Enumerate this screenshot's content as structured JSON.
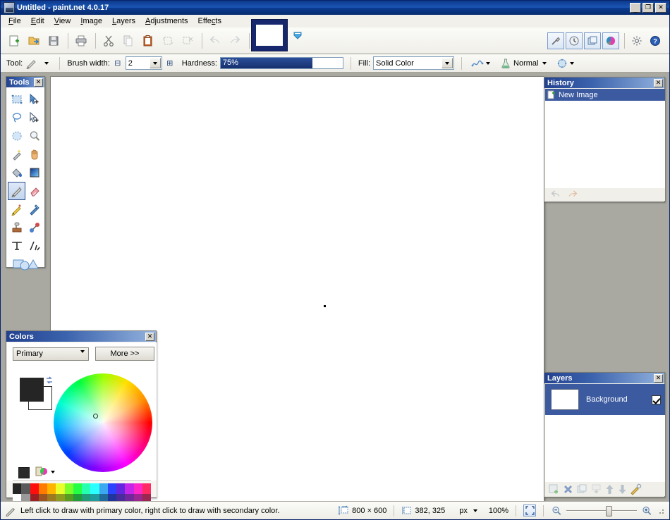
{
  "window": {
    "title": "Untitled - paint.net 4.0.17",
    "icon": "app-icon",
    "minimize_label": "_",
    "maximize_label": "❐",
    "close_label": "✕"
  },
  "menubar": {
    "items": [
      {
        "label": "File",
        "accel": "F"
      },
      {
        "label": "Edit",
        "accel": "E"
      },
      {
        "label": "View",
        "accel": "V"
      },
      {
        "label": "Image",
        "accel": "I"
      },
      {
        "label": "Layers",
        "accel": "L"
      },
      {
        "label": "Adjustments",
        "accel": "A"
      },
      {
        "label": "Effects",
        "accel": "c"
      }
    ]
  },
  "toolbar": {
    "items": [
      {
        "name": "new-icon",
        "tip": "New"
      },
      {
        "name": "open-icon",
        "tip": "Open"
      },
      {
        "name": "save-icon",
        "tip": "Save"
      },
      {
        "name": "print-icon",
        "tip": "Print"
      },
      {
        "name": "cut-icon",
        "tip": "Cut"
      },
      {
        "name": "copy-icon",
        "tip": "Copy"
      },
      {
        "name": "paste-icon",
        "tip": "Paste"
      },
      {
        "name": "crop-to-selection-icon",
        "tip": "Crop to Selection"
      },
      {
        "name": "deselect-all-icon",
        "tip": "Deselect All"
      },
      {
        "name": "undo-icon",
        "tip": "Undo"
      },
      {
        "name": "redo-icon",
        "tip": "Redo"
      },
      {
        "name": "pixel-grid-icon",
        "tip": "Pixel Grid"
      },
      {
        "name": "rulers-icon",
        "tip": "Rulers"
      }
    ],
    "right_toggles": [
      {
        "name": "tools-window-icon",
        "tip": "Tools",
        "active": true
      },
      {
        "name": "history-window-icon",
        "tip": "History",
        "active": true
      },
      {
        "name": "layers-window-icon",
        "tip": "Layers",
        "active": true
      },
      {
        "name": "colors-window-icon",
        "tip": "Colors",
        "active": true
      }
    ],
    "right_plain": [
      {
        "name": "settings-icon",
        "tip": "Settings"
      },
      {
        "name": "help-icon",
        "tip": "Help"
      }
    ]
  },
  "thumbstrip": {
    "active_thumb_name": "image-thumbnail-untitled",
    "dropdown_name": "thumbnail-list-dropdown"
  },
  "options": {
    "tool_label": "Tool:",
    "tool_icon": "paintbrush-icon",
    "brush_width_label": "Brush width:",
    "brush_width_value": "2",
    "decrease_label": "⊟",
    "increase_label": "⊞",
    "hardness_label": "Hardness:",
    "hardness_value": "75%",
    "hardness_percent": 75,
    "fill_label": "Fill:",
    "fill_value": "Solid Color",
    "curve_icon": "curve-style-icon",
    "blend_icon": "blend-mode-flask-icon",
    "blend_value": "Normal",
    "antialias_icon": "antialiasing-icon"
  },
  "tools_panel": {
    "title": "Tools",
    "close_label": "✕",
    "tools": [
      {
        "name": "rectangle-select-tool",
        "label": "Rectangle Select",
        "selected": false
      },
      {
        "name": "move-selected-tool",
        "label": "Move Selected",
        "selected": false
      },
      {
        "name": "lasso-select-tool",
        "label": "Lasso Select",
        "selected": false
      },
      {
        "name": "move-selection-tool",
        "label": "Move Selection",
        "selected": false
      },
      {
        "name": "ellipse-select-tool",
        "label": "Ellipse Select",
        "selected": false
      },
      {
        "name": "zoom-tool",
        "label": "Zoom",
        "selected": false
      },
      {
        "name": "magic-wand-tool",
        "label": "Magic Wand",
        "selected": false
      },
      {
        "name": "pan-tool",
        "label": "Pan",
        "selected": false
      },
      {
        "name": "paint-bucket-tool",
        "label": "Paint Bucket",
        "selected": false
      },
      {
        "name": "gradient-tool",
        "label": "Gradient",
        "selected": false
      },
      {
        "name": "paintbrush-tool",
        "label": "Paintbrush",
        "selected": true
      },
      {
        "name": "eraser-tool",
        "label": "Eraser",
        "selected": false
      },
      {
        "name": "pencil-tool",
        "label": "Pencil",
        "selected": false
      },
      {
        "name": "color-picker-tool",
        "label": "Color Picker",
        "selected": false
      },
      {
        "name": "clone-stamp-tool",
        "label": "Clone Stamp",
        "selected": false
      },
      {
        "name": "recolor-tool",
        "label": "Recolor",
        "selected": false
      },
      {
        "name": "text-tool",
        "label": "Text",
        "selected": false
      },
      {
        "name": "line-curve-tool",
        "label": "Line/Curve",
        "selected": false
      },
      {
        "name": "shapes-tool",
        "label": "Shapes",
        "selected": false
      }
    ]
  },
  "history_panel": {
    "title": "History",
    "close_label": "✕",
    "entries": [
      {
        "label": "New Image",
        "icon": "new-image-icon",
        "selected": true
      }
    ],
    "undo_label": "Undo",
    "redo_label": "Redo"
  },
  "layers_panel": {
    "title": "Layers",
    "close_label": "✕",
    "layers": [
      {
        "name": "Background",
        "visible": true,
        "selected": true
      }
    ],
    "buttons": [
      {
        "name": "add-layer-button",
        "label": "Add New Layer"
      },
      {
        "name": "delete-layer-button",
        "label": "Delete Layer"
      },
      {
        "name": "duplicate-layer-button",
        "label": "Duplicate Layer"
      },
      {
        "name": "merge-layer-down-button",
        "label": "Merge Layer Down"
      },
      {
        "name": "move-layer-up-button",
        "label": "Move Layer Up"
      },
      {
        "name": "move-layer-down-button",
        "label": "Move Layer Down"
      },
      {
        "name": "layer-properties-button",
        "label": "Layer Properties"
      }
    ]
  },
  "colors_panel": {
    "title": "Colors",
    "close_label": "✕",
    "mode_value": "Primary",
    "more_label": "More >>",
    "primary_color": "#252525",
    "secondary_color": "#ffffff",
    "swap_icon": "swap-colors-icon",
    "reset_icon": "reset-colors-icon",
    "palette_icon": "palette-menu-icon",
    "palette_row1": [
      "#252525",
      "#5a5a5a",
      "#ff0e0e",
      "#ff7b00",
      "#ffb400",
      "#e8ff2b",
      "#7bff2b",
      "#23ff45",
      "#25ffb0",
      "#2bffff",
      "#3ba8f0",
      "#2b43ff",
      "#6327e0",
      "#c427e8",
      "#ff27c7",
      "#ff2b62"
    ],
    "palette_row2": [
      "#ffffff",
      "#9a9a9a",
      "#9c1f24",
      "#9c5420",
      "#9c7a20",
      "#8e9c20",
      "#5a9c20",
      "#209c3a",
      "#209c7a",
      "#209c9c",
      "#206b9c",
      "#20359c",
      "#4a2b9c",
      "#73279c",
      "#9c2790",
      "#9c2750"
    ]
  },
  "canvas": {
    "dot_label": "drawn-dot"
  },
  "statusbar": {
    "tool_icon": "paintbrush-icon",
    "hint": "Left click to draw with primary color, right click to draw with secondary color.",
    "size_icon": "image-size-icon",
    "size": "800 × 600",
    "cursor_icon": "cursor-position-icon",
    "cursor": "382, 325",
    "units": "px",
    "zoom": "100%",
    "fit_icon": "fit-to-window-icon",
    "zoom_out_icon": "zoom-out-icon",
    "zoom_in_icon": "zoom-in-icon",
    "zoom_slider_percent": 56
  }
}
